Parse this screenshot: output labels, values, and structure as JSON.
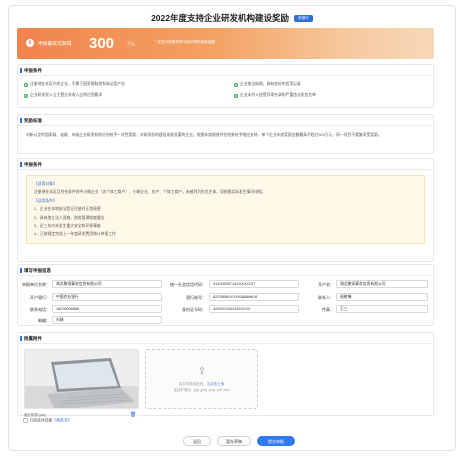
{
  "title": "2022年度支持企业研发机构建设奖励",
  "title_badge": "申报中",
  "banner": {
    "label": "申报最高可获得",
    "amount": "300",
    "unit": "万元",
    "note": "* 仅表示按照政策可能获得的最高金额"
  },
  "conditions": {
    "title": "申报条件",
    "items": [
      "注册地在本区内的企业，不属于国家限制类和淘汰类产业",
      "企业依法纳税，具有良好的信用记录",
      "企业研发投入占主营业务收入比例达到要求",
      "企业未列入经营异常名录和严重违法失信名单"
    ]
  },
  "rewards": {
    "title": "奖励标准",
    "text": "对新认定的国家级、省级、市级企业研发机构分别给予一次性奖励；对研发机构建设成效显著的企业，根据年度绩效评估结果给予相应支持，单个企业年度奖励金额最高不超过300万元，同一项目不重复享受奖励。"
  },
  "apply": {
    "title": "申报条件",
    "tag1": "【适用对象】",
    "line1": "注册地在本区且符合条件的中小微企业（含个体工商户）、小微企业、农户、个体工商户，未被列为失信主体，须按照实际发生情况申报。",
    "tag2": "【适用条件】",
    "items": [
      "1、企业在本地依法登记注册并正常经营",
      "2、具有独立法人资格，财务管理制度健全",
      "3、近三年内未发生重大安全和环保事故",
      "4、已按规定完成上一年度研发费用统计申报工作"
    ]
  },
  "form": {
    "title": "填写申报信息",
    "fields": [
      {
        "label": "申报单位名称：",
        "value": "湖北聚贤事务信息有限公司"
      },
      {
        "label": "统一社会信用代码：",
        "value": "91420506714XXXXX237"
      },
      {
        "label": "开户名：",
        "value": "湖北聚贤事务信息有限公司"
      },
      {
        "label": "开户银行：",
        "value": "中国农业银行"
      },
      {
        "label": "银行账号：",
        "value": "6223858XXXXX68889616"
      },
      {
        "label": "联系人：",
        "value": "周晓锋"
      },
      {
        "label": "联系电话：",
        "value": "18200008888"
      },
      {
        "label": "身份证号码：",
        "value": "4205022004102XXXX"
      },
      {
        "label": "传真：",
        "value": "王三"
      },
      {
        "label": "邮编：",
        "value": "市辖"
      }
    ]
  },
  "attach": {
    "title": "附属附件",
    "file_name": "营业执照.jpeg",
    "upload_tip1": "将文件拖到此处，或",
    "upload_link": "点击上传",
    "upload_tip2": "支持扩展名: .jpg .jpeg .png .pdf .doc"
  },
  "agreement": {
    "prefix": "已阅读并同意",
    "link": "《承诺书》"
  },
  "buttons": {
    "back": "返回",
    "draft": "暂存草稿",
    "submit": "提交申报"
  },
  "colors": {
    "primary": "#2f7af0",
    "banner_start": "#f0844d",
    "banner_end": "#f7d8b9",
    "check": "#33a852"
  }
}
